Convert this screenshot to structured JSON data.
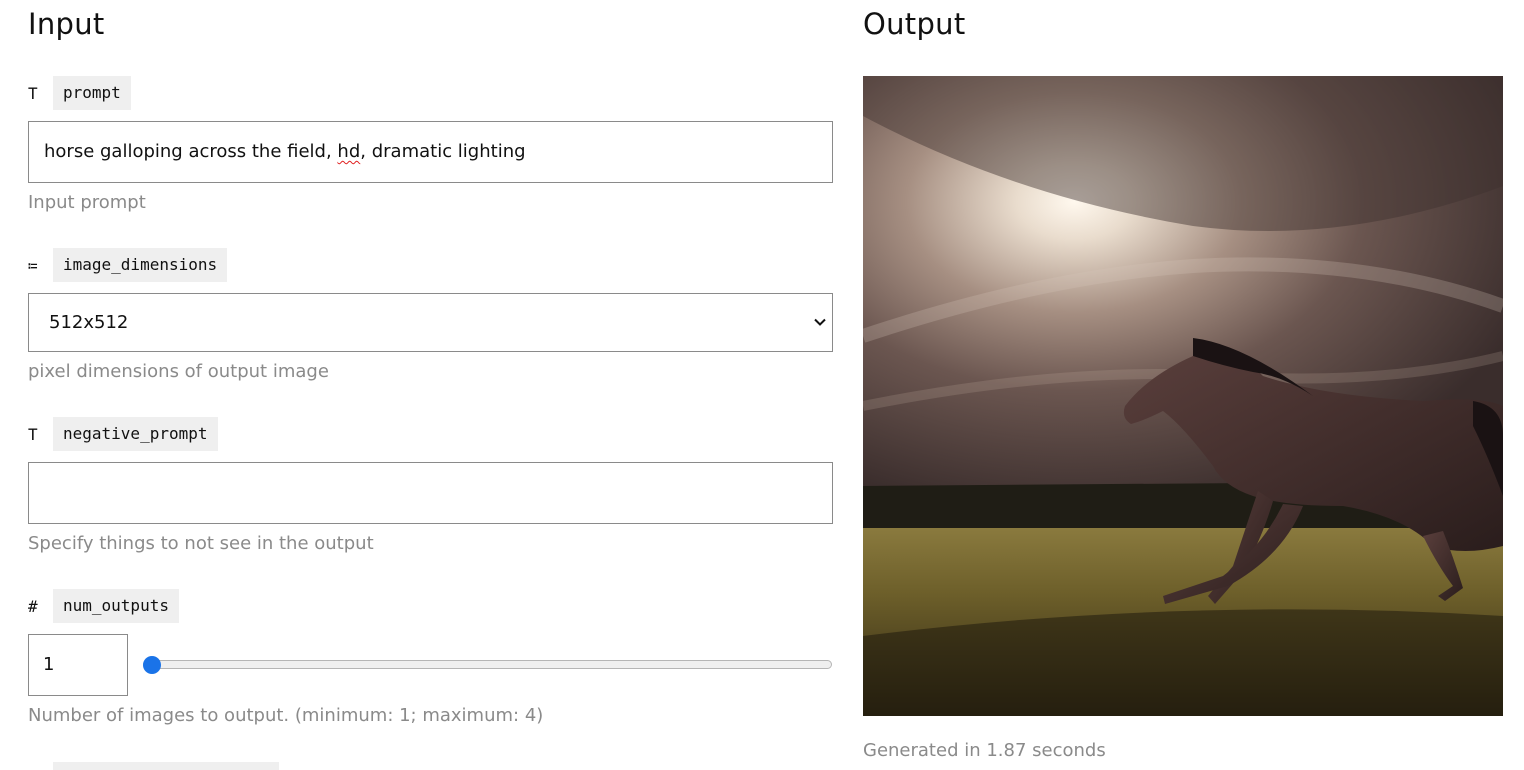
{
  "input": {
    "title": "Input",
    "fields": [
      {
        "type_icon": "T",
        "icon_name": "text-type-icon",
        "name": "prompt",
        "value_prefix": "horse galloping across the field, ",
        "value_flagged": "hd",
        "value_suffix": ", dramatic lighting",
        "help": "Input prompt"
      },
      {
        "type_icon": "≔",
        "icon_name": "list-type-icon",
        "name": "image_dimensions",
        "selected": "512x512",
        "help": "pixel dimensions of output image"
      },
      {
        "type_icon": "T",
        "icon_name": "text-type-icon",
        "name": "negative_prompt",
        "value": "",
        "help": "Specify things to not see in the output"
      },
      {
        "type_icon": "#",
        "icon_name": "number-type-icon",
        "name": "num_outputs",
        "value": "1",
        "min": 1,
        "max": 4,
        "help": "Number of images to output. (minimum: 1; maximum: 4)"
      }
    ]
  },
  "output": {
    "title": "Output",
    "image_description_icon": "generated-horse-image",
    "generated_text": "Generated in 1.87 seconds"
  },
  "colors": {
    "accent": "#1a73e8",
    "muted_text": "#8a8a8a",
    "chip_bg": "#efefef",
    "border": "#8a8a8a"
  }
}
